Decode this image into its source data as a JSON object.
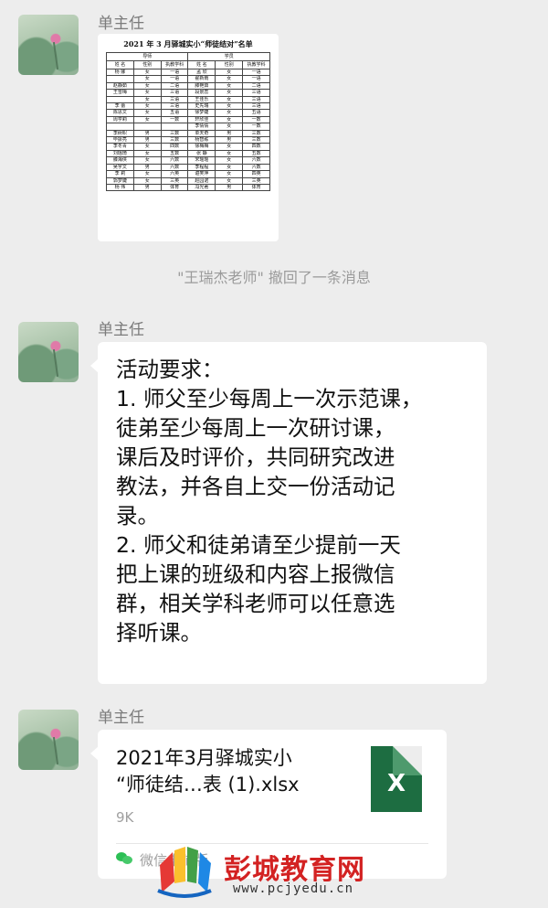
{
  "messages": {
    "first": {
      "sender": "单主任",
      "image": {
        "title": "2021 年 3 月驿城实小“师徒结对”名单",
        "group_headers": [
          "导师",
          "学员"
        ],
        "columns": [
          "姓 名",
          "性别",
          "执教学科",
          "姓 名",
          "性别",
          "执教学科"
        ],
        "rows": [
          [
            "杨  娜",
            "女",
            "一语",
            "孟  欣",
            "女",
            "一语"
          ],
          [
            "",
            "女",
            "一语",
            "翟新雨",
            "女",
            "一语"
          ],
          [
            "赵静茹",
            "女",
            "二语",
            "滕艳茹",
            "女",
            "二语"
          ],
          [
            "王雪梅",
            "女",
            "三语",
            "段景蕊",
            "女",
            "三语"
          ],
          [
            "",
            "女",
            "三语",
            "王佳乐",
            "女",
            "三语"
          ],
          [
            "李  蕾",
            "女",
            "三语",
            "史先瑞",
            "女",
            "三语"
          ],
          [
            "陈思文",
            "女",
            "五语",
            "徐梦婕",
            "女",
            "五语"
          ],
          [
            "周学莉",
            "女",
            "一数",
            "轩欣佳",
            "女",
            "一数"
          ],
          [
            "",
            "",
            "",
            "李倩倩",
            "女",
            "一数"
          ],
          [
            "李树帜",
            "男",
            "三数",
            "单天奇",
            "男",
            "三数"
          ],
          [
            "毕振亮",
            "男",
            "三数",
            "杨智栋",
            "男",
            "三数"
          ],
          [
            "李冬青",
            "女",
            "四数",
            "徐梅梅",
            "女",
            "四数"
          ],
          [
            "刘瑶琦",
            "女",
            "五数",
            "张  静",
            "女",
            "五数"
          ],
          [
            "滕海侠",
            "女",
            "六数",
            "宋瑶瑶",
            "女",
            "六数"
          ],
          [
            "吴宇文",
            "男",
            "六数",
            "李程程",
            "女",
            "六数"
          ],
          [
            "李  莉",
            "女",
            "六英",
            "谌笑萍",
            "女",
            "四英"
          ],
          [
            "郭梦婕",
            "女",
            "三英",
            "赵园诺",
            "女",
            "三英"
          ],
          [
            "杨  伟",
            "男",
            "体育",
            "冯光著",
            "男",
            "体育"
          ]
        ]
      }
    },
    "recall_notice": "\"王瑞杰老师\" 撤回了一条消息",
    "second": {
      "sender": "单主任",
      "lines": [
        "活动要求：",
        "1. 师父至少每周上一次示范课，",
        "徒弟至少每周上一次研讨课，",
        "课后及时评价，共同研究改进",
        "教法，并各自上交一份活动记",
        "录。",
        "2. 师父和徒弟请至少提前一天",
        "把上课的班级和内容上报微信",
        "群，相关学科老师可以任意选",
        "择听课。"
      ]
    },
    "third": {
      "sender": "单主任",
      "file": {
        "name_line1": "2021年3月驿城实小",
        "name_line2": "“师徒结…表 (1).xlsx",
        "size": "9K",
        "icon_letter": "X",
        "icon_name": "excel-file-icon",
        "source": "微信电脑版"
      }
    }
  },
  "watermark": {
    "text": "彭城教育网",
    "url": "www.pcjyedu.cn"
  },
  "colors": {
    "background": "#ededed",
    "bubble": "#ffffff",
    "excel_green": "#1d6d41",
    "watermark_red": "#d32222"
  }
}
